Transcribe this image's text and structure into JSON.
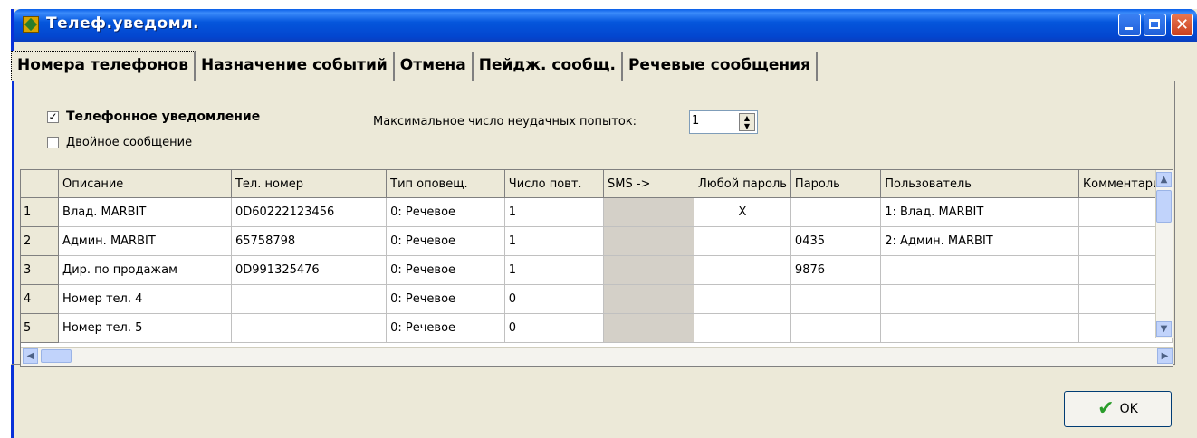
{
  "window": {
    "title": "Телеф.уведомл.",
    "icon": "app-icon",
    "controls": [
      "minimize-icon",
      "maximize-icon",
      "close-icon"
    ]
  },
  "tabs": [
    {
      "label": "Номера телефонов",
      "active": true
    },
    {
      "label": "Назначение событий",
      "active": false
    },
    {
      "label": "Отмена",
      "active": false
    },
    {
      "label": "Пейдж. сообщ.",
      "active": false
    },
    {
      "label": "Речевые сообщения",
      "active": false
    }
  ],
  "options": {
    "phone_notification": {
      "label": "Телефонное уведомление",
      "checked": true
    },
    "double_message": {
      "label": "Двойное сообщение",
      "checked": false
    },
    "max_failed_attempts": {
      "label": "Максимальное число неудачных попыток:",
      "value": "1"
    }
  },
  "grid": {
    "columns": [
      "Описание",
      "Тел. номер",
      "Тип оповещ.",
      "Число повт.",
      "SMS ->",
      "Любой пароль",
      "Пароль",
      "Пользователь",
      "Комментарий"
    ],
    "rows": [
      {
        "num": "1",
        "desc": "Влад. MARBIT",
        "phone": "0D60222123456",
        "type": "0: Речевое",
        "repeat": "1",
        "sms": "",
        "any_pwd": "X",
        "pwd": "",
        "user": "1: Влад. MARBIT",
        "comment": ""
      },
      {
        "num": "2",
        "desc": "Админ. MARBIT",
        "phone": "65758798",
        "type": "0: Речевое",
        "repeat": "1",
        "sms": "",
        "any_pwd": "",
        "pwd": "0435",
        "user": "2: Админ. MARBIT",
        "comment": ""
      },
      {
        "num": "3",
        "desc": "Дир. по продажам",
        "phone": "0D991325476",
        "type": "0: Речевое",
        "repeat": "1",
        "sms": "",
        "any_pwd": "",
        "pwd": "9876",
        "user": "",
        "comment": ""
      },
      {
        "num": "4",
        "desc": "Номер тел. 4",
        "phone": "",
        "type": "0: Речевое",
        "repeat": "0",
        "sms": "",
        "any_pwd": "",
        "pwd": "",
        "user": "",
        "comment": ""
      },
      {
        "num": "5",
        "desc": "Номер тел. 5",
        "phone": "",
        "type": "0: Речевое",
        "repeat": "0",
        "sms": "",
        "any_pwd": "",
        "pwd": "",
        "user": "",
        "comment": ""
      }
    ]
  },
  "buttons": {
    "ok_label": "OK"
  }
}
